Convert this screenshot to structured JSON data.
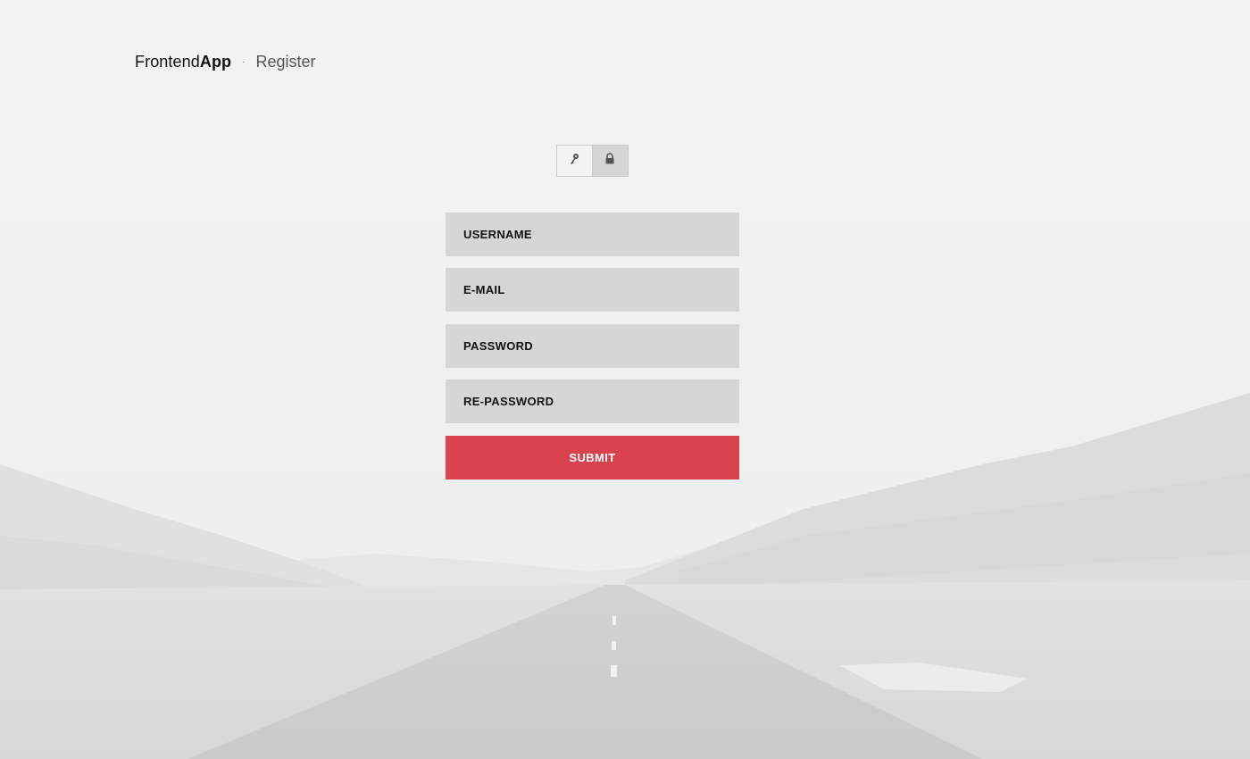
{
  "header": {
    "brand_light": "Frontend",
    "brand_bold": "App",
    "separator": "·",
    "page_name": "Register"
  },
  "auth_switch": {
    "options": [
      {
        "icon": "key-icon",
        "selected": false
      },
      {
        "icon": "lock-icon",
        "selected": true
      }
    ]
  },
  "form": {
    "username_placeholder": "USERNAME",
    "email_placeholder": "E-MAIL",
    "password_placeholder": "PASSWORD",
    "repassword_placeholder": "RE-PASSWORD",
    "submit_label": "SUBMIT"
  },
  "colors": {
    "accent": "#d8434e",
    "field_bg": "#d6d6d6",
    "background": "#f1f1f1"
  }
}
